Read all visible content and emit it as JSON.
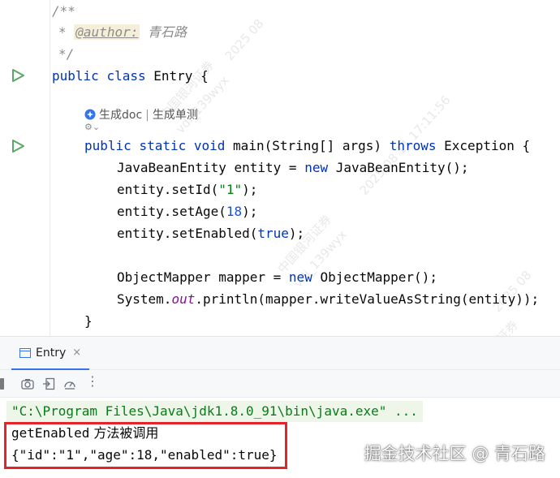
{
  "editor": {
    "doc_open": "/**",
    "doc_star": "*",
    "author_tag": "@author:",
    "author_name": "青石路",
    "doc_close": "*/",
    "class_public": "public",
    "class_kw": "class",
    "class_name": "Entry",
    "class_brace": "{",
    "hint": {
      "generate_doc": "生成doc",
      "separator": "|",
      "generate_test": "生成单测"
    },
    "main": {
      "public": "public",
      "static": "static",
      "void": "void",
      "sig": "main(String[] args)",
      "throws": "throws",
      "exc": "Exception {"
    },
    "line_entity_a": "JavaBeanEntity entity = ",
    "kw_new": "new",
    "line_entity_b": " JavaBeanEntity();",
    "setid_a": "entity.setId(",
    "setid_val": "\"1\"",
    "close_paren": ");",
    "setage_a": "entity.setAge(",
    "setage_val": "18",
    "setenabled_a": "entity.setEnabled(",
    "setenabled_val": "true",
    "mapper_a": "ObjectMapper mapper = ",
    "mapper_b": " ObjectMapper();",
    "println_a": "System.",
    "println_out": "out",
    "println_b": ".println(mapper.writeValueAsString(entity));",
    "method_close": "}"
  },
  "watermarks": {
    "w1": "2025 08",
    "w2": "中国银河证券",
    "w3": "vdi_139wyx",
    "w4": "2025 08 11 17:11:56"
  },
  "run_tab": {
    "label": "Entry",
    "close": "×"
  },
  "toolbar": {
    "more": "⋮"
  },
  "console": {
    "command": "\"C:\\Program Files\\Java\\jdk1.8.0_91\\bin\\java.exe\" ...",
    "output_line1_code": "getEnabled",
    "output_line1_text": " 方法被调用",
    "output_line2": "{\"id\":\"1\",\"age\":18,\"enabled\":true}"
  },
  "brand": "掘金技术社区 @ 青石路",
  "colors": {
    "keyword": "#0033b3",
    "string": "#067d17",
    "number": "#1750eb",
    "field": "#871094",
    "run_green": "#59a869",
    "highlight_red": "#e3242b",
    "tab_accent": "#3574f0"
  }
}
